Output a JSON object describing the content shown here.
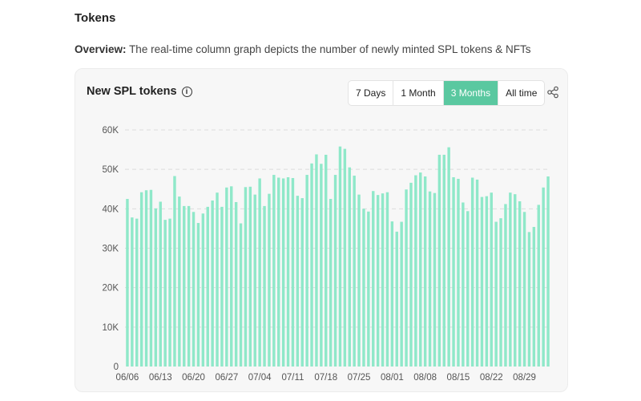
{
  "section_title": "Tokens",
  "overview": {
    "label": "Overview:",
    "text": "The real-time column graph depicts the number of newly minted SPL tokens & NFTs"
  },
  "card": {
    "title": "New SPL tokens",
    "info_icon": "info-icon",
    "share_icon": "share-icon",
    "ranges": [
      "7 Days",
      "1 Month",
      "3 Months",
      "All time"
    ],
    "active_range": "3 Months"
  },
  "colors": {
    "bar": "#8fe8c9",
    "accent": "#5ac8a0",
    "grid": "#dcdcdc"
  },
  "chart_data": {
    "type": "bar",
    "title": "New SPL tokens",
    "xlabel": "",
    "ylabel": "",
    "ylim": [
      0,
      60000
    ],
    "yticks": [
      "0",
      "10K",
      "20K",
      "30K",
      "40K",
      "50K",
      "60K"
    ],
    "xtick_labels": [
      "06/06",
      "06/13",
      "06/20",
      "06/27",
      "07/04",
      "07/11",
      "07/18",
      "07/25",
      "08/01",
      "08/08",
      "08/15",
      "08/22",
      "08/29"
    ],
    "grid": true,
    "categories": [
      "06/06",
      "06/07",
      "06/08",
      "06/09",
      "06/10",
      "06/11",
      "06/12",
      "06/13",
      "06/14",
      "06/15",
      "06/16",
      "06/17",
      "06/18",
      "06/19",
      "06/20",
      "06/21",
      "06/22",
      "06/23",
      "06/24",
      "06/25",
      "06/26",
      "06/27",
      "06/28",
      "06/29",
      "06/30",
      "07/01",
      "07/02",
      "07/03",
      "07/04",
      "07/05",
      "07/06",
      "07/07",
      "07/08",
      "07/09",
      "07/10",
      "07/11",
      "07/12",
      "07/13",
      "07/14",
      "07/15",
      "07/16",
      "07/17",
      "07/18",
      "07/19",
      "07/20",
      "07/21",
      "07/22",
      "07/23",
      "07/24",
      "07/25",
      "07/26",
      "07/27",
      "07/28",
      "07/29",
      "07/30",
      "07/31",
      "08/01",
      "08/02",
      "08/03",
      "08/04",
      "08/05",
      "08/06",
      "08/07",
      "08/08",
      "08/09",
      "08/10",
      "08/11",
      "08/12",
      "08/13",
      "08/14",
      "08/15",
      "08/16",
      "08/17",
      "08/18",
      "08/19",
      "08/20",
      "08/21",
      "08/22",
      "08/23",
      "08/24",
      "08/25",
      "08/26",
      "08/27",
      "08/28",
      "08/29",
      "08/30",
      "08/31",
      "09/01",
      "09/02",
      "09/03"
    ],
    "values": [
      42500,
      37800,
      37500,
      44200,
      44700,
      44800,
      40100,
      41800,
      37200,
      37500,
      48300,
      43100,
      40700,
      40700,
      39200,
      36400,
      38800,
      40500,
      42100,
      44100,
      40500,
      45400,
      45700,
      41700,
      36300,
      45500,
      45600,
      43600,
      47700,
      40700,
      43800,
      48600,
      47900,
      47700,
      48000,
      47800,
      43300,
      42700,
      48600,
      51500,
      53800,
      51400,
      53700,
      42500,
      48600,
      55800,
      55200,
      50500,
      48400,
      43600,
      40000,
      39300,
      44500,
      43500,
      43900,
      44200,
      36800,
      34200,
      36700,
      44900,
      46600,
      48500,
      49200,
      48200,
      44400,
      44000,
      53700,
      53700,
      55600,
      48000,
      47600,
      41600,
      39400,
      47900,
      47400,
      43000,
      43200,
      44100,
      36700,
      37600,
      41200,
      44100,
      43700,
      41900,
      39200,
      34100,
      35400,
      41000,
      45400,
      48200
    ]
  }
}
